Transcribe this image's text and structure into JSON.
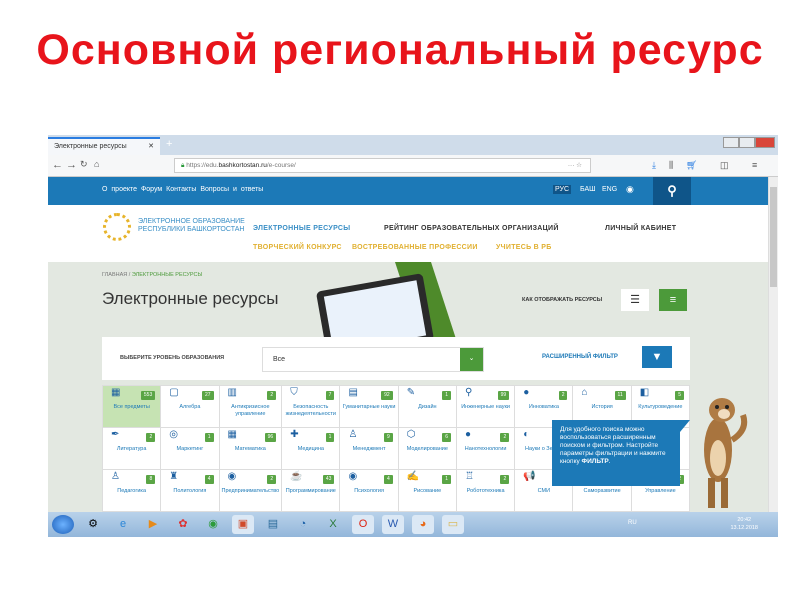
{
  "slide_title": "Основной региональный ресурс",
  "browser": {
    "tab_title": "Электронные ресурсы",
    "url_prefix": "https://edu.",
    "url_domain": "bashkortostan.ru",
    "url_path": "/e-course/"
  },
  "topbar": {
    "links": "О проекте  Форум  Контакты  Вопросы и ответы",
    "langs": [
      "РУС",
      "БАШ",
      "ENG"
    ],
    "active_lang": "РУС"
  },
  "logo": {
    "line1": "ЭЛЕКТРОННОЕ ОБРАЗОВАНИЕ",
    "line2": "РЕСПУБЛИКИ БАШКОРТОСТАН"
  },
  "menu": {
    "main": [
      "ЭЛЕКТРОННЫЕ РЕСУРСЫ",
      "РЕЙТИНГ ОБРАЗОВАТЕЛЬНЫХ ОРГАНИЗАЦИЙ",
      "ЛИЧНЫЙ КАБИНЕТ"
    ],
    "secondary": [
      "ТВОРЧЕСКИЙ КОНКУРС",
      "ВОСТРЕБОВАННЫЕ ПРОФЕССИИ",
      "УЧИТЕСЬ В РБ"
    ]
  },
  "breadcrumb": {
    "home": "ГЛАВНАЯ",
    "sep": " / ",
    "current": "ЭЛЕКТРОННЫЕ РЕСУРСЫ"
  },
  "page_title": "Электронные ресурсы",
  "view_label": "КАК ОТОБРАЖАТЬ РЕСУРСЫ",
  "filter": {
    "label": "ВЫБЕРИТЕ УРОВЕНЬ ОБРАЗОВАНИЯ",
    "value": "Все",
    "advanced": "РАСШИРЕННЫЙ ФИЛЬТР"
  },
  "categories": [
    {
      "name": "Все предметы",
      "count": "553",
      "icon": "▦",
      "active": true
    },
    {
      "name": "Алгебра",
      "count": "27",
      "icon": "▢"
    },
    {
      "name": "Антикризисное управление",
      "count": "2",
      "icon": "▥"
    },
    {
      "name": "Безопасность жизнедеятельности",
      "count": "7",
      "icon": "⛉"
    },
    {
      "name": "Гуманитарные науки",
      "count": "92",
      "icon": "▤"
    },
    {
      "name": "Дизайн",
      "count": "1",
      "icon": "✎"
    },
    {
      "name": "Инженерные науки",
      "count": "99",
      "icon": "⚲"
    },
    {
      "name": "Инноватика",
      "count": "2",
      "icon": "●"
    },
    {
      "name": "История",
      "count": "11",
      "icon": "⌂"
    },
    {
      "name": "Культуроведение",
      "count": "5",
      "icon": "◧"
    },
    {
      "name": "Литература",
      "count": "2",
      "icon": "✒"
    },
    {
      "name": "Маркетинг",
      "count": "1",
      "icon": "◎"
    },
    {
      "name": "Математика",
      "count": "96",
      "icon": "▦"
    },
    {
      "name": "Медицина",
      "count": "1",
      "icon": "✚"
    },
    {
      "name": "Менеджмент",
      "count": "9",
      "icon": "♙"
    },
    {
      "name": "Моделирование",
      "count": "6",
      "icon": "⬡"
    },
    {
      "name": "Нанотехнологии",
      "count": "2",
      "icon": "●"
    },
    {
      "name": "Науки о Земле",
      "count": "",
      "icon": "◐"
    },
    {
      "name": "",
      "count": "",
      "icon": ""
    },
    {
      "name": "",
      "count": "",
      "icon": ""
    },
    {
      "name": "Педагогика",
      "count": "8",
      "icon": "♙"
    },
    {
      "name": "Политология",
      "count": "4",
      "icon": "♜"
    },
    {
      "name": "Предпринимательство",
      "count": "2",
      "icon": "◉"
    },
    {
      "name": "Программирование",
      "count": "43",
      "icon": "☕"
    },
    {
      "name": "Психология",
      "count": "4",
      "icon": "◉"
    },
    {
      "name": "Рисование",
      "count": "1",
      "icon": "✍"
    },
    {
      "name": "Робототехника",
      "count": "2",
      "icon": "♖"
    },
    {
      "name": "СМИ",
      "count": "1",
      "icon": "📢"
    },
    {
      "name": "Саморазвитие",
      "count": "12",
      "icon": "●"
    },
    {
      "name": "Управление",
      "count": "12",
      "icon": "♟"
    }
  ],
  "tooltip": {
    "text": "Для удобного поиска можно воспользоваться расширенным поиском и фильтром. Настройте параметры фильтрации и нажмите кнопку ",
    "bold": "ФИЛЬТР",
    "end": "."
  },
  "taskbar": {
    "lang": "RU",
    "time": "20:42",
    "date": "13.12.2018"
  },
  "colors": {
    "title": "#e8141b",
    "blue": "#1c79b7",
    "green": "#4c9a3a",
    "content_bg": "#e3e8e1"
  }
}
